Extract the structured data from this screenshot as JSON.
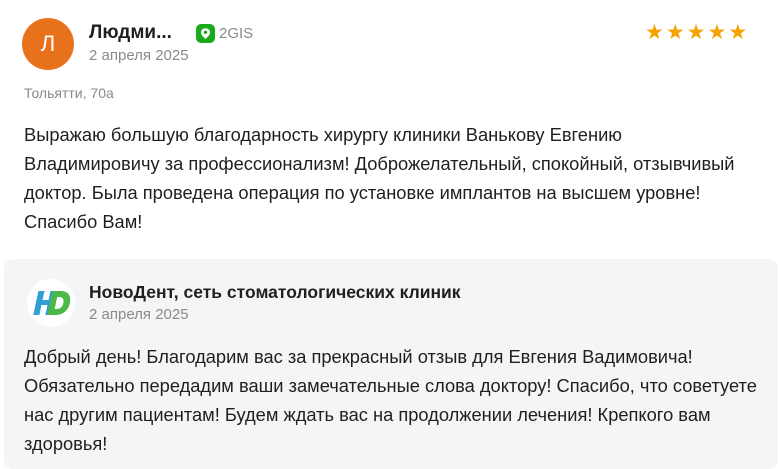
{
  "review": {
    "avatar_letter": "Л",
    "avatar_color": "#e8711c",
    "author": "Людми...",
    "source_label": "2GIS",
    "source_icon": "2gis-logo-icon",
    "date": "2 апреля 2025",
    "rating": 5,
    "star_color": "#f4a300",
    "address": "Тольятти, 70а",
    "text": "Выражаю большую благодарность хирургу клиники Ванькову Евгению Владимировичу за профессионализм! Доброжелательный, спокойный, отзывчивый доктор. Была проведена операция по установке имплантов на высшем уровне! Спасибо Вам!"
  },
  "reply": {
    "org_name": "НовоДент, сеть стоматологических клиник",
    "org_logo": "novodent-logo-icon",
    "date": "2 апреля 2025",
    "text": "Добрый день! Благодарим вас за прекрасный отзыв для Евгения Вадимовича! Обязательно передадим ваши замечательные слова доктору! Спасибо, что советуете нас другим пациентам! Будем ждать вас на продолжении лечения! Крепкого вам здоровья!"
  }
}
